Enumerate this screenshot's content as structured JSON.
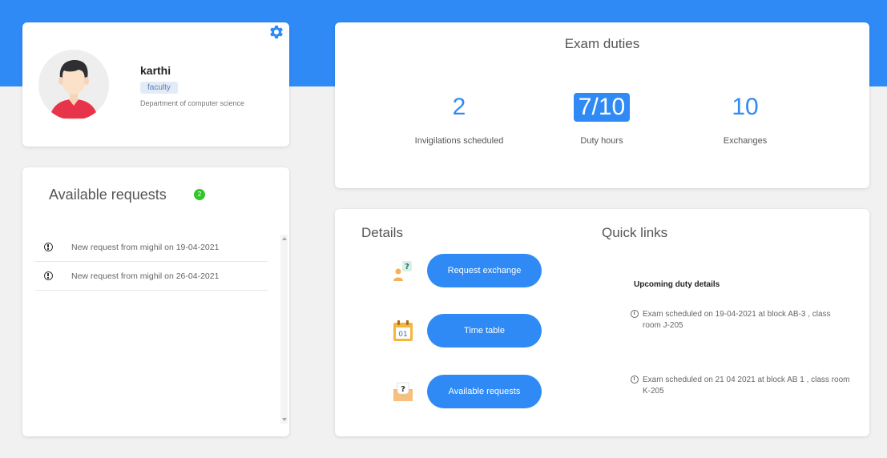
{
  "profile": {
    "name": "karthi",
    "role": "faculty",
    "department": "Department of computer science",
    "settings_icon": "gear-icon"
  },
  "requests": {
    "title": "Available requests",
    "count": "2",
    "items": [
      {
        "text": "New request from mighil on 19-04-2021",
        "icon": "info-icon"
      },
      {
        "text": "New request from mighil on 26-04-2021",
        "icon": "info-icon"
      }
    ]
  },
  "duties": {
    "title": "Exam duties",
    "stats": [
      {
        "value": "2",
        "label": "Invigilations scheduled"
      },
      {
        "value": "7/10",
        "label": "Duty hours"
      },
      {
        "value": "10",
        "label": "Exchanges"
      }
    ]
  },
  "details": {
    "title": "Details",
    "actions": [
      {
        "label": "Request exchange",
        "icon": "request-exchange-icon"
      },
      {
        "label": "Time table",
        "icon": "calendar-icon"
      },
      {
        "label": "Available requests",
        "icon": "envelope-question-icon"
      }
    ]
  },
  "quick_links": {
    "title": "Quick links",
    "upcoming_title": "Upcoming duty details",
    "items": [
      {
        "text": "Exam scheduled on 19-04-2021 at block AB-3 , class room J-205",
        "icon": "clock-icon"
      },
      {
        "text": "Exam scheduled on 21 04 2021 at block AB 1 , class room K-205",
        "icon": "clock-icon"
      }
    ]
  },
  "colors": {
    "accent": "#2f8af5",
    "badge_green": "#34c52a",
    "background": "#f1f1f1"
  }
}
